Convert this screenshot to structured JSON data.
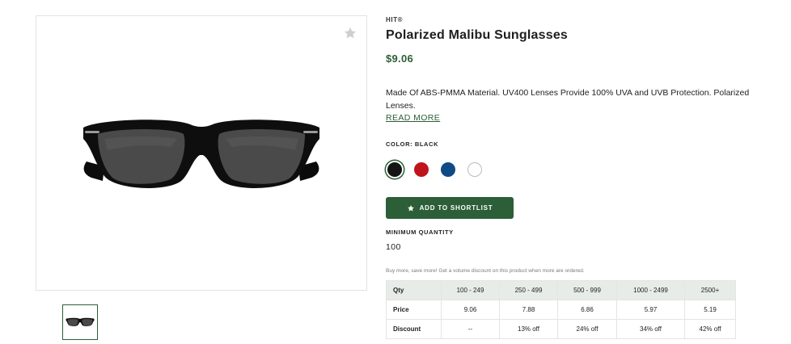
{
  "product": {
    "brand": "HIT®",
    "title": "Polarized Malibu Sunglasses",
    "price": "$9.06",
    "description": "Made Of ABS-PMMA Material. UV400 Lenses Provide 100% UVA and UVB Protection. Polarized Lenses.",
    "read_more": "READ MORE",
    "color_label": "COLOR: BLACK",
    "colors": [
      {
        "name": "black",
        "hex": "#141414",
        "selected": true
      },
      {
        "name": "red",
        "hex": "#c0141c",
        "selected": false
      },
      {
        "name": "blue",
        "hex": "#0e4a86",
        "selected": false
      },
      {
        "name": "white",
        "hex": "#ffffff",
        "selected": false
      }
    ],
    "shortlist_button": "ADD TO SHORTLIST",
    "min_qty_label": "MINIMUM QUANTITY",
    "min_qty_value": "100",
    "promo_text": "Buy more, save more! Get a volume discount on this product when more are ordered."
  },
  "pricing_table": {
    "headers": [
      "Qty",
      "100 - 249",
      "250 - 499",
      "500 - 999",
      "1000 - 2499",
      "2500+"
    ],
    "rows": [
      [
        "Price",
        "9.06",
        "7.88",
        "6.86",
        "5.97",
        "5.19"
      ],
      [
        "Discount",
        "--",
        "13% off",
        "24% off",
        "34% off",
        "42% off"
      ]
    ]
  },
  "icons": {
    "favorite": "star-icon",
    "shortlist": "star-icon",
    "product_image": "sunglasses-image"
  },
  "colors": {
    "accent": "#2c5e37",
    "table_header_bg": "#e8ece9",
    "border": "#e3e3e3"
  }
}
